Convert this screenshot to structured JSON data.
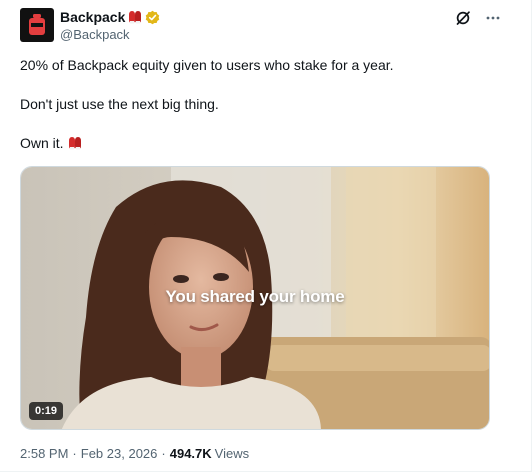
{
  "author": {
    "display_name": "Backpack",
    "handle": "@Backpack",
    "avatar_icon": "backpack-logo-icon",
    "name_emoji": "boxing-gloves-icon",
    "verified_icon": "verified-gold-badge-icon"
  },
  "actions": {
    "grok_icon": "grok-icon",
    "more_icon": "more-dots-icon"
  },
  "tweet": {
    "paragraphs": [
      "20% of Backpack equity given to users who stake for a year.",
      "Don't just use the next big thing.",
      "Own it."
    ],
    "trailing_emoji": "boxing-gloves-icon"
  },
  "media": {
    "caption": "You shared your home",
    "duration": "0:19"
  },
  "meta": {
    "time": "2:58 PM",
    "separator": "·",
    "date": "Feb 23, 2026",
    "views_count": "494.7K",
    "views_label": "Views"
  },
  "colors": {
    "brand_red": "#e33e3f",
    "verified_gold": "#e2b719",
    "secondary_text": "#536471"
  }
}
